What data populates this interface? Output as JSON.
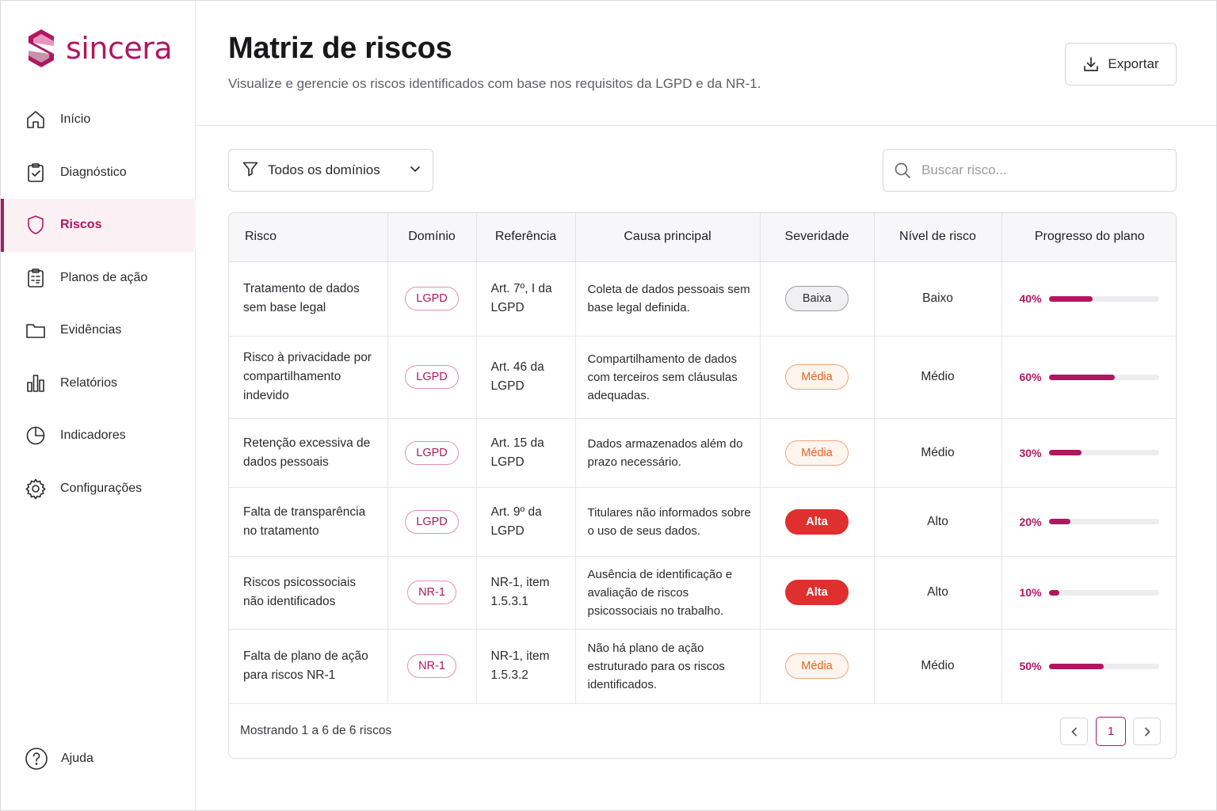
{
  "brand": {
    "name": "sincera",
    "color": "#b0175f"
  },
  "sidebar": {
    "items": [
      {
        "label": "Início",
        "icon": "home-icon",
        "active": false
      },
      {
        "label": "Diagnóstico",
        "icon": "clipboard-check-icon",
        "active": false
      },
      {
        "label": "Riscos",
        "icon": "shield-icon",
        "active": true
      },
      {
        "label": "Planos de ação",
        "icon": "clipboard-list-icon",
        "active": false
      },
      {
        "label": "Evidências",
        "icon": "folder-icon",
        "active": false
      },
      {
        "label": "Relatórios",
        "icon": "bar-chart-icon",
        "active": false
      },
      {
        "label": "Indicadores",
        "icon": "pie-chart-icon",
        "active": false
      },
      {
        "label": "Configurações",
        "icon": "gear-icon",
        "active": false
      }
    ],
    "help_label": "Ajuda"
  },
  "header": {
    "title": "Matriz de riscos",
    "subtitle": "Visualize e gerencie os riscos identificados com base nos requisitos da LGPD e da NR-1.",
    "export_label": "Exportar"
  },
  "filters": {
    "domain_selected": "Todos os domínios",
    "search_placeholder": "Buscar risco..."
  },
  "table": {
    "columns": [
      "Risco",
      "Domínio",
      "Referência",
      "Causa principal",
      "Severidade",
      "Nível de risco",
      "Progresso do plano"
    ],
    "rows": [
      {
        "risk": "Tratamento de dados sem base legal",
        "domain": "LGPD",
        "reference": "Art. 7º, I da LGPD",
        "cause": "Coleta de dados pessoais sem base legal definida.",
        "severity": "Baixa",
        "level": "Baixo",
        "progress": 40,
        "progress_label": "40%"
      },
      {
        "risk": "Risco à privacidade por compartilhamento indevido",
        "domain": "LGPD",
        "reference": "Art. 46 da LGPD",
        "cause": "Compartilhamento de dados com terceiros sem cláusulas adequadas.",
        "severity": "Média",
        "level": "Médio",
        "progress": 60,
        "progress_label": "60%"
      },
      {
        "risk": "Retenção excessiva de dados pessoais",
        "domain": "LGPD",
        "reference": "Art. 15 da LGPD",
        "cause": "Dados armazenados além do prazo necessário.",
        "severity": "Média",
        "level": "Médio",
        "progress": 30,
        "progress_label": "30%"
      },
      {
        "risk": "Falta de transparência no tratamento",
        "domain": "LGPD",
        "reference": "Art. 9º da LGPD",
        "cause": "Titulares não informados sobre o uso de seus dados.",
        "severity": "Alta",
        "level": "Alto",
        "progress": 20,
        "progress_label": "20%"
      },
      {
        "risk": "Riscos psicossociais não identificados",
        "domain": "NR-1",
        "reference": "NR-1, item 1.5.3.1",
        "cause": "Ausência de identificação e avaliação de riscos psicossociais no trabalho.",
        "severity": "Alta",
        "level": "Alto",
        "progress": 10,
        "progress_label": "10%"
      },
      {
        "risk": "Falta de plano de ação para riscos NR-1",
        "domain": "NR-1",
        "reference": "NR-1, item 1.5.3.2",
        "cause": "Não há plano de ação estruturado para os riscos identificados.",
        "severity": "Média",
        "level": "Médio",
        "progress": 50,
        "progress_label": "50%"
      }
    ],
    "footer_text": "Mostrando 1 a 6 de 6 riscos",
    "current_page": "1"
  },
  "colors": {
    "accent": "#b0175f",
    "severity_baixa": "#9d9da5",
    "severity_media": "#e8621e",
    "severity_alta": "#e02f2f"
  }
}
